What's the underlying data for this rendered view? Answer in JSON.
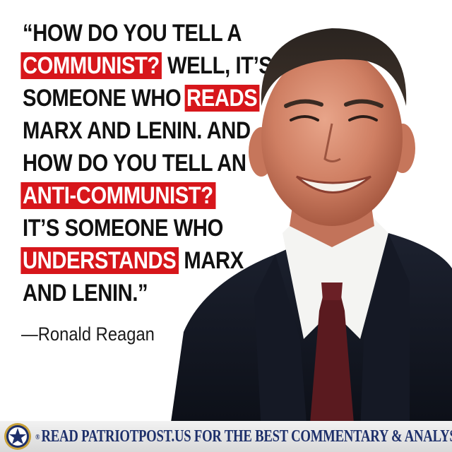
{
  "quote": {
    "line1": "“HOW DO YOU TELL A",
    "line2_hl": "COMMUNIST?",
    "line2_rest": " WELL, IT’S",
    "line3_pre": "SOMEONE WHO ",
    "line3_hl": "READS",
    "line4": "MARX AND LENIN. AND",
    "line5": "HOW DO YOU TELL AN",
    "line6_hl": "ANTI-COMMUNIST?",
    "line7": "IT’S SOMEONE WHO",
    "line8_hl": "UNDERSTANDS",
    "line8_rest": " MARX",
    "line9": "AND LENIN.”"
  },
  "attribution": "—Ronald Reagan",
  "footer": {
    "registered": "®",
    "text": "READ PATRIOTPOST.US FOR THE BEST COMMENTARY & ANALYSIS"
  },
  "colors": {
    "highlight": "#d7161b",
    "footer_text": "#1d2f6a",
    "badge": "#1d2f6a"
  },
  "icons": {
    "badge": "patriot-post-star-badge-icon",
    "portrait": "ronald-reagan-portrait"
  }
}
